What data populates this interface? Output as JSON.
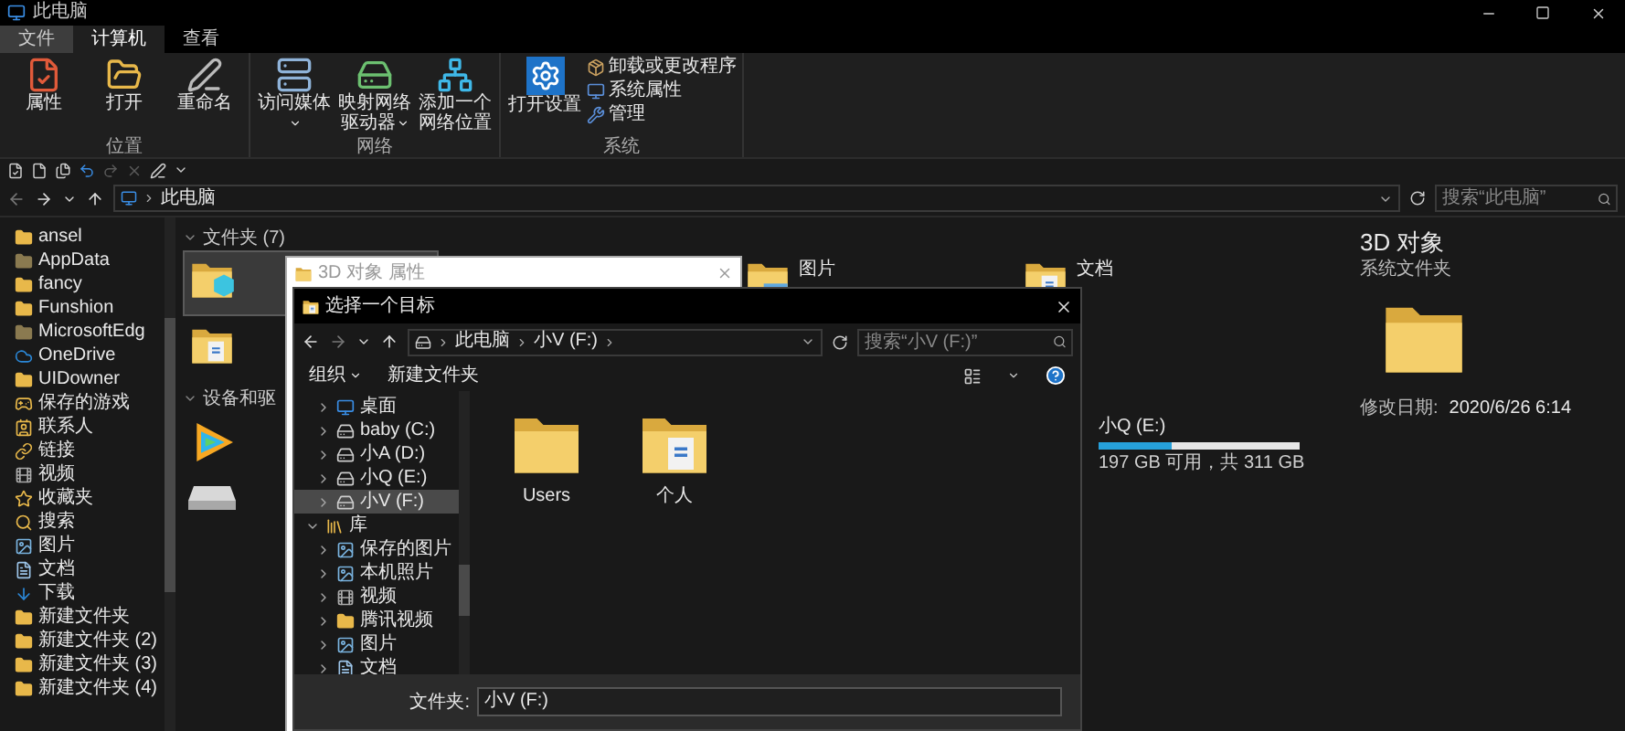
{
  "window": {
    "title": "此电脑"
  },
  "ribbon_tabs": [
    {
      "label": "文件",
      "kind": "menu",
      "selected": false
    },
    {
      "label": "计算机",
      "kind": "tab",
      "selected": true
    },
    {
      "label": "查看",
      "kind": "tab",
      "selected": false
    }
  ],
  "ribbon_groups": [
    {
      "label": "位置",
      "buttons": [
        {
          "label": "属性",
          "kind": "large",
          "dropdown": false
        },
        {
          "label": "打开",
          "kind": "large",
          "dropdown": false
        },
        {
          "label": "重命名",
          "kind": "large",
          "dropdown": false
        }
      ]
    },
    {
      "label": "网络",
      "buttons": [
        {
          "label": "访问媒体",
          "kind": "large",
          "dropdown": true
        },
        {
          "label": "映射网络驱动器",
          "kind": "large",
          "dropdown": true
        },
        {
          "label": "添加一个网络位置",
          "kind": "large",
          "dropdown": false
        }
      ]
    },
    {
      "label": "系统",
      "buttons": [
        {
          "label": "打开设置",
          "kind": "large",
          "dropdown": false
        },
        {
          "label": "卸载或更改程序",
          "kind": "small"
        },
        {
          "label": "系统属性",
          "kind": "small"
        },
        {
          "label": "管理",
          "kind": "small"
        }
      ]
    }
  ],
  "quick_access": [
    {
      "disabled": false
    },
    {
      "disabled": false
    },
    {
      "disabled": false
    },
    {
      "disabled": false
    },
    {
      "disabled": true
    },
    {
      "disabled": true
    },
    {
      "disabled": false
    }
  ],
  "address_bar": {
    "path": [
      "此电脑"
    ],
    "search_placeholder": "搜索“此电脑”"
  },
  "sidebar": {
    "items": [
      {
        "label": "ansel",
        "kind": "folder"
      },
      {
        "label": "AppData",
        "kind": "folder_dim"
      },
      {
        "label": "fancy",
        "kind": "folder"
      },
      {
        "label": "Funshion",
        "kind": "folder"
      },
      {
        "label": "MicrosoftEdg",
        "kind": "folder_dim"
      },
      {
        "label": "OneDrive",
        "kind": "cloud"
      },
      {
        "label": "UIDowner",
        "kind": "folder"
      },
      {
        "label": "保存的游戏",
        "kind": "games"
      },
      {
        "label": "联系人",
        "kind": "contacts"
      },
      {
        "label": "链接",
        "kind": "link"
      },
      {
        "label": "视频",
        "kind": "video"
      },
      {
        "label": "收藏夹",
        "kind": "favorites"
      },
      {
        "label": "搜索",
        "kind": "search"
      },
      {
        "label": "图片",
        "kind": "pictures"
      },
      {
        "label": "文档",
        "kind": "docs"
      },
      {
        "label": "下载",
        "kind": "download"
      },
      {
        "label": "新建文件夹",
        "kind": "folder"
      },
      {
        "label": "新建文件夹 (2)",
        "kind": "folder"
      },
      {
        "label": "新建文件夹 (3)",
        "kind": "folder"
      },
      {
        "label": "新建文件夹 (4)",
        "kind": "folder"
      }
    ]
  },
  "content": {
    "sections": [
      {
        "title": "文件夹 (7)",
        "expanded": true,
        "items": [
          {
            "kind": "cube",
            "selected": true
          },
          {
            "label": "图片",
            "kind": "pictures",
            "selected": false
          },
          {
            "label": "文档",
            "kind": "docs",
            "selected": false
          },
          {
            "kind": "docs",
            "selected": false
          }
        ]
      },
      {
        "title": "设备和驱",
        "expanded": true,
        "items": [
          {
            "kind": "app",
            "selected": false
          },
          {
            "label": "小Q (E:)",
            "kind": "drive_usage",
            "selected": false,
            "level": 0.36,
            "space": "197 GB 可用，共 311 GB"
          },
          {
            "kind": "drive",
            "selected": false
          }
        ]
      }
    ]
  },
  "details": {
    "title": "3D 对象",
    "subtitle": "系统文件夹",
    "modified_label": "修改日期:",
    "modified": "2020/6/26 6:14"
  },
  "properties_dialog": {
    "title": "3D 对象 属性"
  },
  "picker_dialog": {
    "title": "选择一个目标",
    "path": [
      "此电脑",
      "小V (F:)"
    ],
    "search_placeholder": "搜索“小V (F:)”",
    "toolbar": {
      "organize": "组织",
      "new_folder": "新建文件夹"
    },
    "tree": [
      {
        "label": "桌面",
        "kind": "desktop",
        "selected": false,
        "expanded": false
      },
      {
        "label": "baby (C:)",
        "kind": "drive",
        "selected": false,
        "expanded": false
      },
      {
        "label": "小A (D:)",
        "kind": "drive",
        "selected": false,
        "expanded": false
      },
      {
        "label": "小Q (E:)",
        "kind": "drive",
        "selected": false,
        "expanded": false
      },
      {
        "label": "小V (F:)",
        "kind": "drive",
        "selected": true,
        "expanded": false
      },
      {
        "label": "库",
        "kind": "library",
        "selected": false,
        "expanded": true,
        "children": [
          {
            "label": "保存的图片",
            "kind": "pictures",
            "selected": false,
            "expanded": false
          },
          {
            "label": "本机照片",
            "kind": "pictures",
            "selected": false,
            "expanded": false
          },
          {
            "label": "视频",
            "kind": "video",
            "selected": false,
            "expanded": false
          },
          {
            "label": "腾讯视频",
            "kind": "folder",
            "selected": false,
            "expanded": false
          },
          {
            "label": "图片",
            "kind": "pictures",
            "selected": false,
            "expanded": false
          },
          {
            "label": "文档",
            "kind": "docs",
            "selected": false,
            "expanded": false
          }
        ]
      }
    ],
    "items": [
      {
        "label": "Users",
        "kind": "folder"
      },
      {
        "label": "个人",
        "kind": "docs"
      }
    ],
    "folder_label": "文件夹:",
    "folder_value": "小V (F:)"
  }
}
